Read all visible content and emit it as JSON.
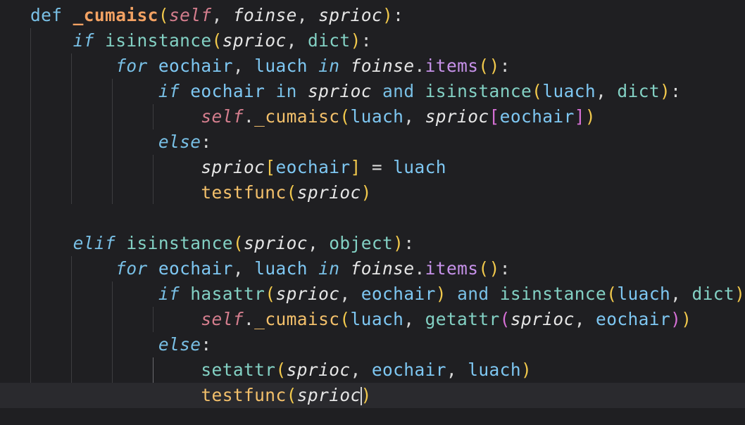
{
  "editor": {
    "language": "python",
    "current_line": 16,
    "lines": [
      "def _cumaisc(self, foinse, sprioc):",
      "    if isinstance(sprioc, dict):",
      "        for eochair, luach in foinse.items():",
      "            if eochair in sprioc and isinstance(luach, dict):",
      "                self._cumaisc(luach, sprioc[eochair])",
      "            else:",
      "                sprioc[eochair] = luach",
      "                testfunc(sprioc)",
      "",
      "    elif isinstance(sprioc, object):",
      "        for eochair, luach in foinse.items():",
      "            if hasattr(sprioc, eochair) and isinstance(luach, dict):",
      "                self._cumaisc(luach, getattr(sprioc, eochair))",
      "            else:",
      "                setattr(sprioc, eochair, luach)",
      "                testfunc(sprioc)"
    ]
  },
  "colors": {
    "background": "#1f1f22",
    "current_line": "#2a2a2e",
    "keyword": "#79c0e6",
    "function_call": "#f3c06b",
    "function_def": "#f3a263",
    "builtin": "#83d1c4",
    "self_param": "#d57e8e",
    "variable": "#7ec7f2",
    "bracket_level1": "#f2c94c",
    "bracket_level2": "#d670d6",
    "bracket_level3": "#4aa3ff",
    "method": "#c792ea"
  }
}
